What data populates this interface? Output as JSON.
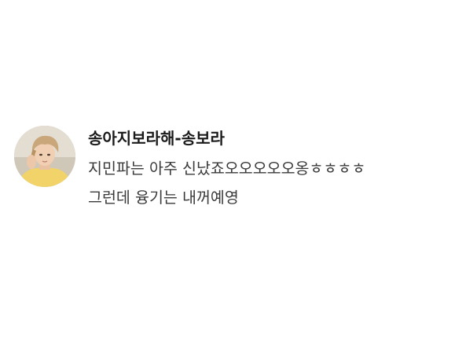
{
  "comment": {
    "author": "송아지보라해-송보라",
    "lines": [
      "지민파는 아주 신났죠오오오오오옹ㅎㅎㅎㅎ",
      "그런데 융기는 내꺼예영"
    ],
    "avatar_icon": "user-avatar-photo"
  },
  "colors": {
    "background": "#ffffff",
    "author_text": "#1a1a1a",
    "body_text": "#3a3a3a"
  }
}
